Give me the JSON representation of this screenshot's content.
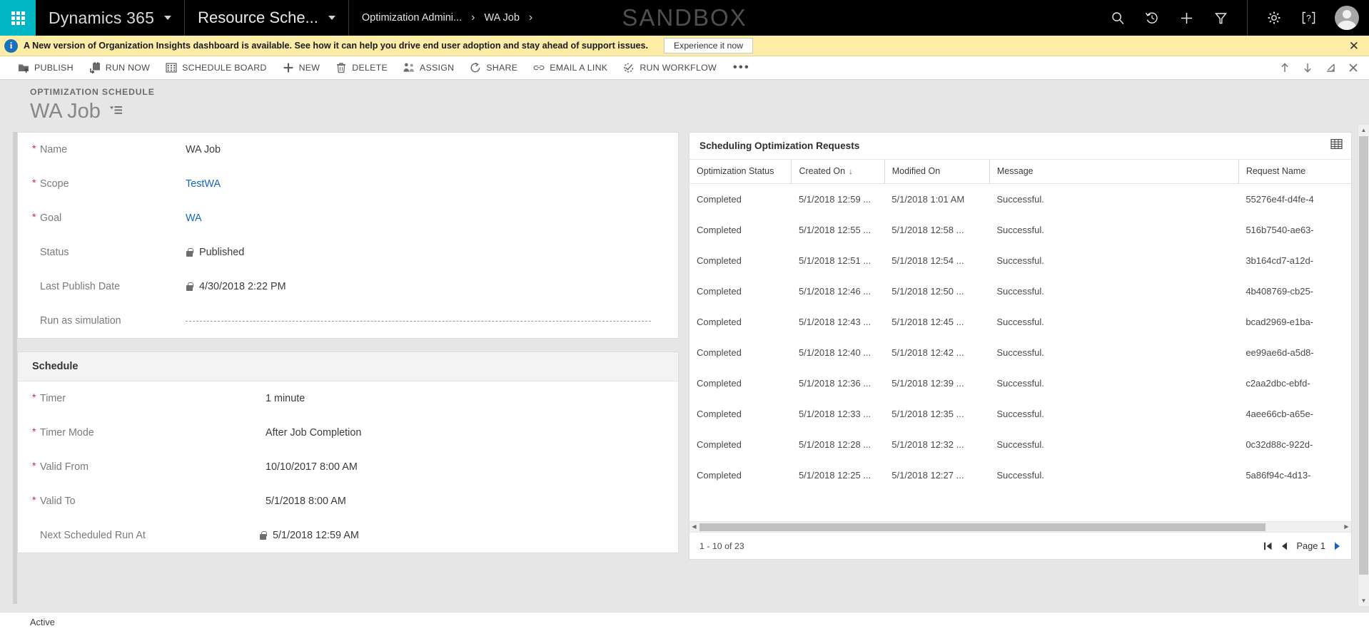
{
  "topnav": {
    "waffle_icon": "waffle-grid-icon",
    "brand": "Dynamics 365",
    "app_name": "Resource Sche...",
    "breadcrumbs": [
      {
        "label": "Optimization Admini...",
        "arrow": "›"
      },
      {
        "label": "WA Job",
        "arrow": "›"
      }
    ],
    "environment_watermark": "SANDBOX",
    "icons": [
      {
        "name": "search-icon",
        "title": "Search"
      },
      {
        "name": "recent-history-icon",
        "title": "Recently Viewed"
      },
      {
        "name": "quick-create-icon",
        "title": "Quick Create"
      },
      {
        "name": "advanced-find-icon",
        "title": "Advanced Find"
      },
      {
        "name": "gear-icon",
        "title": "Settings"
      },
      {
        "name": "help-icon",
        "title": "Help"
      }
    ],
    "avatar_icon": "user-avatar"
  },
  "notification": {
    "info_icon": "info-icon",
    "glyph": "i",
    "message": "A New version of Organization Insights dashboard is available. See how it can help you drive end user adoption and stay ahead of support issues.",
    "action_label": "Experience it now",
    "close_icon": "close-icon",
    "close_glyph": "✕",
    "bg_color": "#ffeca6"
  },
  "commandbar": {
    "commands": [
      {
        "label": "PUBLISH",
        "icon": "publish-icon"
      },
      {
        "label": "RUN NOW",
        "icon": "run-now-icon"
      },
      {
        "label": "SCHEDULE BOARD",
        "icon": "schedule-board-icon"
      },
      {
        "label": "NEW",
        "icon": "plus-icon"
      },
      {
        "label": "DELETE",
        "icon": "trash-icon"
      },
      {
        "label": "ASSIGN",
        "icon": "assign-users-icon"
      },
      {
        "label": "SHARE",
        "icon": "share-icon"
      },
      {
        "label": "EMAIL A LINK",
        "icon": "link-icon"
      },
      {
        "label": "RUN WORKFLOW",
        "icon": "workflow-icon"
      }
    ],
    "overflow_label": "•••",
    "right_icons": [
      {
        "name": "previous-record-up-icon",
        "glyph": "↑"
      },
      {
        "name": "next-record-down-icon",
        "glyph": "↓"
      },
      {
        "name": "popout-window-icon",
        "glyph": "⬈"
      },
      {
        "name": "close-record-icon",
        "glyph": "✕"
      }
    ]
  },
  "pageheader": {
    "entity_label": "OPTIMIZATION SCHEDULE",
    "record_title": "WA Job",
    "title_menu_icon": "form-selector-icon"
  },
  "form": {
    "general": {
      "fields": [
        {
          "label": "Name",
          "value": "WA Job",
          "required": true,
          "locked": false,
          "link": false,
          "empty": false
        },
        {
          "label": "Scope",
          "value": "TestWA",
          "required": true,
          "locked": false,
          "link": true,
          "empty": false
        },
        {
          "label": "Goal",
          "value": "WA",
          "required": true,
          "locked": false,
          "link": true,
          "empty": false
        },
        {
          "label": "Status",
          "value": "Published",
          "required": false,
          "locked": true,
          "link": false,
          "empty": false
        },
        {
          "label": "Last Publish Date",
          "value": "4/30/2018  2:22 PM",
          "required": false,
          "locked": true,
          "link": false,
          "empty": false
        },
        {
          "label": "Run as simulation",
          "value": "",
          "required": false,
          "locked": false,
          "link": false,
          "empty": true
        }
      ]
    },
    "schedule": {
      "section_title": "Schedule",
      "fields": [
        {
          "label": "Timer",
          "value": "1 minute",
          "required": true,
          "locked": false,
          "link": false,
          "empty": false
        },
        {
          "label": "Timer Mode",
          "value": "After Job Completion",
          "required": true,
          "locked": false,
          "link": false,
          "empty": false
        },
        {
          "label": "Valid From",
          "value": "10/10/2017  8:00 AM",
          "required": true,
          "locked": false,
          "link": false,
          "empty": false
        },
        {
          "label": "Valid To",
          "value": "5/1/2018  8:00 AM",
          "required": true,
          "locked": false,
          "link": false,
          "empty": false
        },
        {
          "label": "Next Scheduled Run At",
          "value": "5/1/2018  12:59 AM",
          "required": false,
          "locked": true,
          "link": false,
          "empty": false
        }
      ]
    }
  },
  "grid": {
    "title": "Scheduling Optimization Requests",
    "head_icon": "open-grid-icon",
    "columns": [
      {
        "label": "Optimization Status",
        "sorted": false
      },
      {
        "label": "Created On",
        "sorted": true,
        "sort_glyph": "↓"
      },
      {
        "label": "Modified On",
        "sorted": false
      },
      {
        "label": "Message",
        "sorted": false
      },
      {
        "label": "Request Name",
        "sorted": false
      }
    ],
    "rows": [
      {
        "status": "Completed",
        "created_on": "5/1/2018 12:59 ...",
        "modified_on": "5/1/2018 1:01 AM",
        "message": "Successful.",
        "request_name": "55276e4f-d4fe-4"
      },
      {
        "status": "Completed",
        "created_on": "5/1/2018 12:55 ...",
        "modified_on": "5/1/2018 12:58 ...",
        "message": "Successful.",
        "request_name": "516b7540-ae63-"
      },
      {
        "status": "Completed",
        "created_on": "5/1/2018 12:51 ...",
        "modified_on": "5/1/2018 12:54 ...",
        "message": "Successful.",
        "request_name": "3b164cd7-a12d-"
      },
      {
        "status": "Completed",
        "created_on": "5/1/2018 12:46 ...",
        "modified_on": "5/1/2018 12:50 ...",
        "message": "Successful.",
        "request_name": "4b408769-cb25-"
      },
      {
        "status": "Completed",
        "created_on": "5/1/2018 12:43 ...",
        "modified_on": "5/1/2018 12:45 ...",
        "message": "Successful.",
        "request_name": "bcad2969-e1ba-"
      },
      {
        "status": "Completed",
        "created_on": "5/1/2018 12:40 ...",
        "modified_on": "5/1/2018 12:42 ...",
        "message": "Successful.",
        "request_name": "ee99ae6d-a5d8-"
      },
      {
        "status": "Completed",
        "created_on": "5/1/2018 12:36 ...",
        "modified_on": "5/1/2018 12:39 ...",
        "message": "Successful.",
        "request_name": "c2aa2dbc-ebfd-"
      },
      {
        "status": "Completed",
        "created_on": "5/1/2018 12:33 ...",
        "modified_on": "5/1/2018 12:35 ...",
        "message": "Successful.",
        "request_name": "4aee66cb-a65e-"
      },
      {
        "status": "Completed",
        "created_on": "5/1/2018 12:28 ...",
        "modified_on": "5/1/2018 12:32 ...",
        "message": "Successful.",
        "request_name": "0c32d88c-922d-"
      },
      {
        "status": "Completed",
        "created_on": "5/1/2018 12:25 ...",
        "modified_on": "5/1/2018 12:27 ...",
        "message": "Successful.",
        "request_name": "5a86f94c-4d13-"
      }
    ],
    "footer": {
      "record_count": "1 - 10 of 23",
      "page_label": "Page 1",
      "first_page_icon": "first-page-icon",
      "prev_page_icon": "previous-page-icon",
      "next_page_icon": "next-page-icon"
    },
    "hscroll": {
      "left_arrow": "◀",
      "right_arrow": "▶"
    }
  },
  "footer": {
    "status": "Active"
  },
  "colors": {
    "accent": "#00b7c3",
    "link": "#1565c0",
    "required": "#cc2929",
    "notification_bg": "#ffeca6",
    "nav_bg": "#000000"
  }
}
